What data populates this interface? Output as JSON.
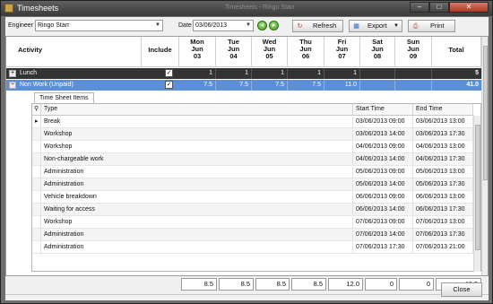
{
  "window": {
    "title": "Timesheets",
    "ghost_title": "Timesheets - Ringo Starr"
  },
  "toolbar": {
    "engineer_label": "Engineer",
    "engineer_value": "Ringo Starr",
    "date_label": "Date",
    "date_value": "03/06/2013",
    "refresh_label": "Refresh",
    "export_label": "Export",
    "print_label": "Print"
  },
  "grid": {
    "headers": {
      "activity": "Activity",
      "include": "Include",
      "days": [
        {
          "d": "Mon",
          "m": "Jun",
          "n": "03"
        },
        {
          "d": "Tue",
          "m": "Jun",
          "n": "04"
        },
        {
          "d": "Wed",
          "m": "Jun",
          "n": "05"
        },
        {
          "d": "Thu",
          "m": "Jun",
          "n": "06"
        },
        {
          "d": "Fri",
          "m": "Jun",
          "n": "07"
        },
        {
          "d": "Sat",
          "m": "Jun",
          "n": "08"
        },
        {
          "d": "Sun",
          "m": "Jun",
          "n": "09"
        }
      ],
      "total": "Total"
    },
    "rows": [
      {
        "expander": "+",
        "activity": "Lunch",
        "include": true,
        "values": [
          "1",
          "1",
          "1",
          "1",
          "1",
          "",
          ""
        ],
        "total": "5"
      },
      {
        "expander": "−",
        "activity": "Non Work (Unpaid)",
        "include": true,
        "values": [
          "7.5",
          "7.5",
          "7.5",
          "7.5",
          "11.0",
          "",
          ""
        ],
        "total": "41.0"
      }
    ],
    "detail": {
      "tab": "Time Sheet Items",
      "columns": [
        "Type",
        "Start Time",
        "End Time"
      ],
      "items": [
        {
          "type": "Break",
          "start": "03/06/2013 09:00",
          "end": "03/06/2013 13:00"
        },
        {
          "type": "Workshop",
          "start": "03/06/2013 14:00",
          "end": "03/06/2013 17:30"
        },
        {
          "type": "Workshop",
          "start": "04/06/2013 09:00",
          "end": "04/06/2013 13:00"
        },
        {
          "type": "Non-chargeable work",
          "start": "04/06/2013 14:00",
          "end": "04/06/2013 17:30"
        },
        {
          "type": "Administration",
          "start": "05/06/2013 09:00",
          "end": "05/06/2013 13:00"
        },
        {
          "type": "Administration",
          "start": "05/06/2013 14:00",
          "end": "05/06/2013 17:30"
        },
        {
          "type": "Vehicle breakdown",
          "start": "06/06/2013 09:00",
          "end": "06/06/2013 13:00"
        },
        {
          "type": "Waiting for access",
          "start": "06/06/2013 14:00",
          "end": "06/06/2013 17:30"
        },
        {
          "type": "Workshop",
          "start": "07/06/2013 09:00",
          "end": "07/06/2013 13:00"
        },
        {
          "type": "Administration",
          "start": "07/06/2013 14:00",
          "end": "07/06/2013 17:30"
        },
        {
          "type": "Administration",
          "start": "07/06/2013 17:30",
          "end": "07/06/2013 21:00"
        }
      ]
    }
  },
  "totals": [
    "8.5",
    "8.5",
    "8.5",
    "8.5",
    "12.0",
    "0",
    "0",
    "46.0"
  ],
  "close_label": "Close",
  "colors": {
    "selected_row": "#5b8fd6",
    "dark_row": "#333333",
    "nav_green": "#3f9a22"
  }
}
